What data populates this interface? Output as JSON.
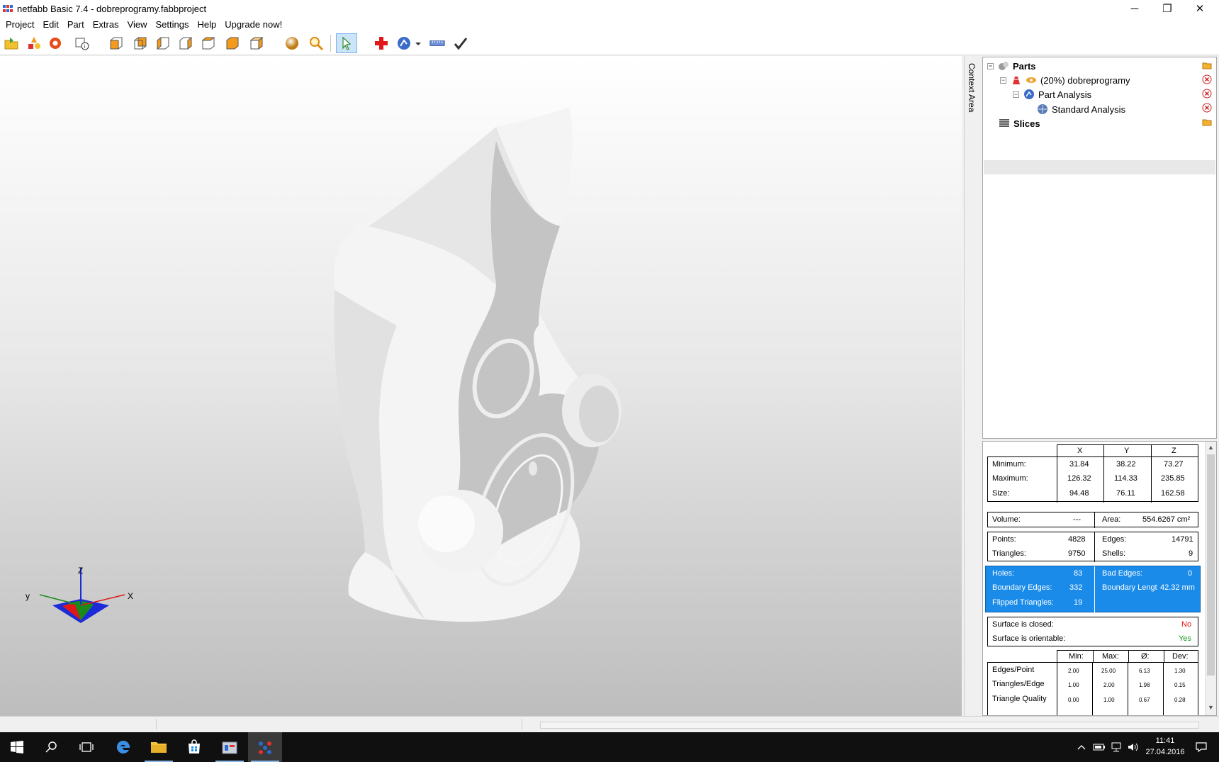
{
  "window": {
    "title": "netfabb Basic 7.4 - dobreprogramy.fabbproject",
    "minimize_glyph": "─",
    "restore_glyph": "❐",
    "close_glyph": "✕"
  },
  "menu": [
    "Project",
    "Edit",
    "Part",
    "Extras",
    "View",
    "Settings",
    "Help",
    "Upgrade now!"
  ],
  "toolbar_icons": [
    "open-project-icon",
    "add-part-icon",
    "repair-icon",
    "part-info-icon",
    "view-front-icon",
    "view-back-icon",
    "view-left-icon",
    "view-right-icon",
    "view-top-icon",
    "view-bottom-icon",
    "view-iso-icon",
    "sphere-icon",
    "zoom-icon",
    "select-pointer-icon",
    "add-analysis-icon",
    "analysis-icon",
    "measure-icon",
    "apply-check-icon"
  ],
  "context_tab_label": "Context Area",
  "tree": {
    "parts_label": "Parts",
    "part_label": "(20%) dobreprogramy",
    "analysis_label": "Part Analysis",
    "standard_label": "Standard Analysis",
    "slices_label": "Slices"
  },
  "analysis": {
    "headers": [
      "X",
      "Y",
      "Z"
    ],
    "rows": [
      {
        "label": "Minimum:",
        "x": "31.84",
        "y": "38.22",
        "z": "73.27"
      },
      {
        "label": "Maximum:",
        "x": "126.32",
        "y": "114.33",
        "z": "235.85"
      },
      {
        "label": "Size:",
        "x": "94.48",
        "y": "76.11",
        "z": "162.58"
      }
    ],
    "volume_label": "Volume:",
    "volume_value": "---",
    "area_label": "Area:",
    "area_value": "554.6267 cm²",
    "points_label": "Points:",
    "points_value": "4828",
    "edges_label": "Edges:",
    "edges_value": "14791",
    "triangles_label": "Triangles:",
    "triangles_value": "9750",
    "shells_label": "Shells:",
    "shells_value": "9",
    "holes_label": "Holes:",
    "holes_value": "83",
    "bad_edges_label": "Bad Edges:",
    "bad_edges_value": "0",
    "boundary_edges_label": "Boundary Edges:",
    "boundary_edges_value": "332",
    "boundary_length_label": "Boundary Lengt",
    "boundary_length_value": "42.32 mm",
    "flipped_label": "Flipped Triangles:",
    "flipped_value": "19",
    "closed_label": "Surface is closed:",
    "closed_value": "No",
    "orientable_label": "Surface is orientable:",
    "orientable_value": "Yes",
    "stat_headers": [
      "Min:",
      "Max:",
      "Ø:",
      "Dev:"
    ],
    "stats": [
      {
        "label": "Edges/Point",
        "values": [
          "2.00",
          "25.00",
          "6.13",
          "1.30"
        ]
      },
      {
        "label": "Triangles/Edge",
        "values": [
          "1.00",
          "2.00",
          "1.98",
          "0.15"
        ]
      },
      {
        "label": "Triangle Quality",
        "values": [
          "0.00",
          "1.00",
          "0.67",
          "0.28"
        ]
      }
    ]
  },
  "axis": {
    "z": "Z",
    "y": "y",
    "x": "X"
  },
  "taskbar": {
    "apps": [
      "start-icon",
      "search-icon",
      "task-view-icon",
      "edge-icon",
      "file-explorer-icon",
      "store-icon",
      "app-icon",
      "netfabb-icon"
    ],
    "time": "11:41",
    "date": "27.04.2016"
  },
  "colors": {
    "accent": "#1a8be8",
    "error": "#e01010",
    "ok": "#1c9c1c",
    "taskbar": "#101010"
  }
}
